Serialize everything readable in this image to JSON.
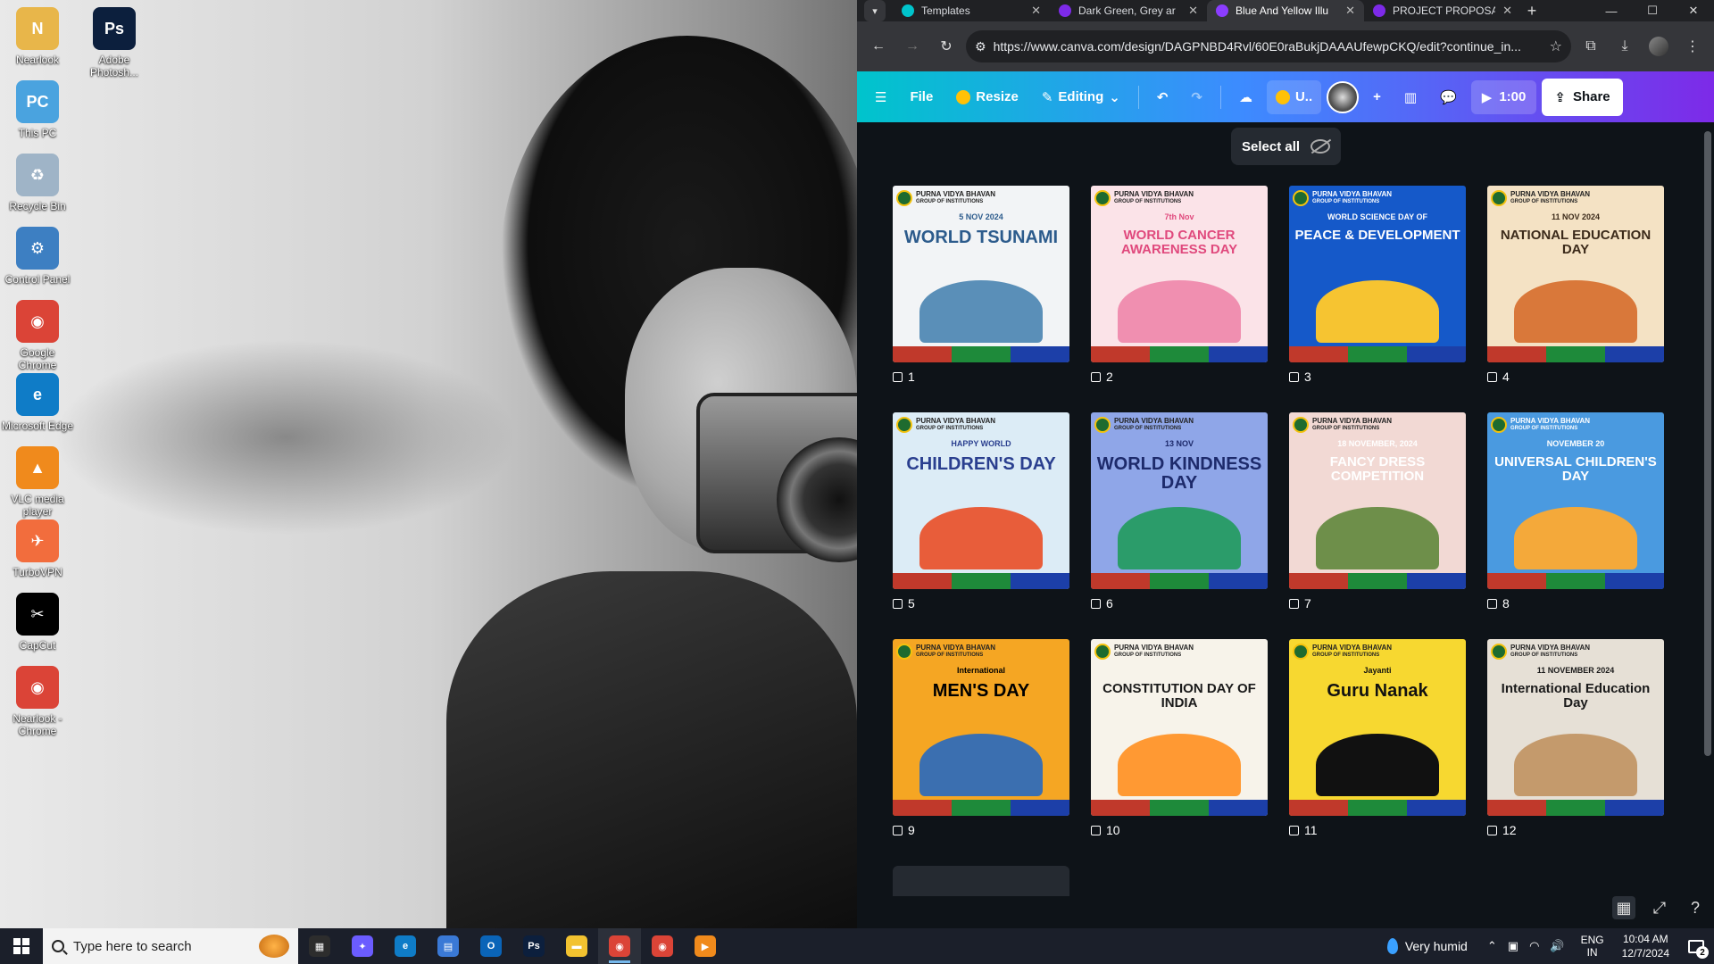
{
  "desktop": {
    "icons": [
      {
        "label": "Nearlook",
        "color": "#e8b64a",
        "glyph": "N"
      },
      {
        "label": "Adobe Photosh...",
        "color": "#0c1f3d",
        "glyph": "Ps"
      },
      {
        "label": "This PC",
        "color": "#4aa3df",
        "glyph": "PC"
      },
      {
        "label": "Recycle Bin",
        "color": "#9fb4c7",
        "glyph": "♻"
      },
      {
        "label": "Control Panel",
        "color": "#3d7fc2",
        "glyph": "⚙"
      },
      {
        "label": "Google Chrome",
        "color": "#db4437",
        "glyph": "◉"
      },
      {
        "label": "Microsoft Edge",
        "color": "#0f7cc7",
        "glyph": "e"
      },
      {
        "label": "VLC media player",
        "color": "#f08a1c",
        "glyph": "▲"
      },
      {
        "label": "TurboVPN",
        "color": "#f26d3d",
        "glyph": "✈"
      },
      {
        "label": "CapCut",
        "color": "#000000",
        "glyph": "✂"
      },
      {
        "label": "Nearlook - Chrome",
        "color": "#db4437",
        "glyph": "◉"
      }
    ]
  },
  "browser": {
    "tabs": [
      {
        "title": "Templates",
        "favicon": "#00c4cc",
        "active": false
      },
      {
        "title": "Dark Green, Grey ar",
        "favicon": "#7d2ae8",
        "active": false
      },
      {
        "title": "Blue And Yellow Illu",
        "favicon": "#8b3dff",
        "active": true
      },
      {
        "title": "PROJECT PROPOSA",
        "favicon": "#7d2ae8",
        "active": false
      }
    ],
    "url": "https://www.canva.com/design/DAGPNBD4Rvl/60E0raBukjDAAAUfewpCKQ/edit?continue_in..."
  },
  "canva": {
    "file_label": "File",
    "resize_label": "Resize",
    "editing_label": "Editing",
    "user_label": "U..",
    "timer_label": "1:00",
    "share_label": "Share",
    "select_all_label": "Select all"
  },
  "pages": [
    {
      "num": "1",
      "title": "WORLD TSUNAMI",
      "sub": "5 NOV 2024",
      "bg": "#f2f4f6",
      "fg": "#2c5b8c",
      "art": "#5a8fb8"
    },
    {
      "num": "2",
      "title": "WORLD CANCER AWARENESS DAY",
      "sub": "7th Nov",
      "bg": "#fbe3e8",
      "fg": "#e0497d",
      "art": "#f08fb0"
    },
    {
      "num": "3",
      "title": "PEACE & DEVELOPMENT",
      "sub": "WORLD SCIENCE DAY OF",
      "bg": "#1559c9",
      "fg": "#ffffff",
      "art": "#f6c431"
    },
    {
      "num": "4",
      "title": "NATIONAL EDUCATION DAY",
      "sub": "11 NOV 2024",
      "bg": "#f4e2c4",
      "fg": "#3b2a1a",
      "art": "#d9783a"
    },
    {
      "num": "5",
      "title": "CHILDREN'S DAY",
      "sub": "HAPPY WORLD",
      "bg": "#dcecf6",
      "fg": "#2a3f8f",
      "art": "#e85d3a"
    },
    {
      "num": "6",
      "title": "WORLD KINDNESS DAY",
      "sub": "13 NOV",
      "bg": "#8fa6e8",
      "fg": "#1d2a6b",
      "art": "#2b9c6a"
    },
    {
      "num": "7",
      "title": "FANCY DRESS COMPETITION",
      "sub": "18 NOVEMBER, 2024",
      "bg": "#f2d9d4",
      "fg": "#ffffff",
      "art": "#6e8f4a"
    },
    {
      "num": "8",
      "title": "UNIVERSAL CHILDREN'S DAY",
      "sub": "NOVEMBER 20",
      "bg": "#4a9ae0",
      "fg": "#ffffff",
      "art": "#f4a93a"
    },
    {
      "num": "9",
      "title": "MEN'S DAY",
      "sub": "International",
      "bg": "#f5a623",
      "fg": "#000000",
      "art": "#3b6fb0"
    },
    {
      "num": "10",
      "title": "CONSTITUTION DAY OF INDIA",
      "sub": "",
      "bg": "#f7f3ea",
      "fg": "#1a1a1a",
      "art": "#ff9933"
    },
    {
      "num": "11",
      "title": "Guru Nanak",
      "sub": "Jayanti",
      "bg": "#f7d830",
      "fg": "#111111",
      "art": "#111111"
    },
    {
      "num": "12",
      "title": "International Education Day",
      "sub": "11 NOVEMBER 2024",
      "bg": "#e6e0d6",
      "fg": "#1a1a1a",
      "art": "#c49a6c"
    }
  ],
  "school": {
    "name_line1": "PURNA VIDYA BHAVAN",
    "name_line2": "GROUP OF INSTITUTIONS"
  },
  "taskbar": {
    "search_placeholder": "Type here to search",
    "weather": "Very humid",
    "lang_line1": "ENG",
    "lang_line2": "IN",
    "time": "10:04 AM",
    "date": "12/7/2024",
    "notif_count": "2",
    "apps": [
      {
        "name": "task-view",
        "color": "#2d2d2d",
        "glyph": "▦",
        "active": false
      },
      {
        "name": "copilot",
        "color": "#6b5cff",
        "glyph": "✦",
        "active": false
      },
      {
        "name": "edge",
        "color": "#0f7cc7",
        "glyph": "e",
        "active": false
      },
      {
        "name": "store",
        "color": "#3a79d6",
        "glyph": "▤",
        "active": false
      },
      {
        "name": "outlook",
        "color": "#0a64b8",
        "glyph": "O",
        "active": false
      },
      {
        "name": "photoshop",
        "color": "#0c1f3d",
        "glyph": "Ps",
        "active": false
      },
      {
        "name": "file-explorer",
        "color": "#f2c230",
        "glyph": "▬",
        "active": false
      },
      {
        "name": "chrome",
        "color": "#db4437",
        "glyph": "◉",
        "active": true
      },
      {
        "name": "chrome-profile",
        "color": "#db4437",
        "glyph": "◉",
        "active": false
      },
      {
        "name": "vlc-like",
        "color": "#f08a1c",
        "glyph": "▶",
        "active": false
      }
    ]
  }
}
